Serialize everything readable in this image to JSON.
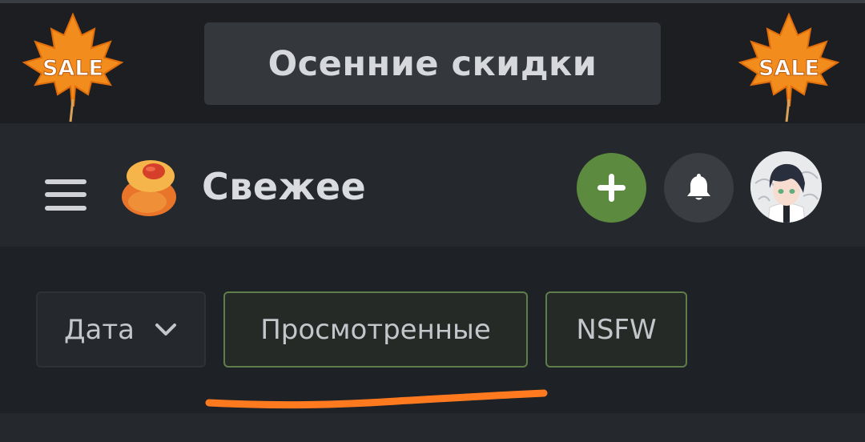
{
  "promo": {
    "button_label": "Осенние скидки",
    "badge_text": "SALE",
    "leaf_color": "#f28c1c"
  },
  "header": {
    "title": "Свежее",
    "add_icon": "plus-icon",
    "notification_icon": "bell-icon",
    "accent_green": "#5c8a3e"
  },
  "filters": {
    "date_label": "Дата",
    "date_icon": "chevron-down-icon",
    "viewed_label": "Просмотренные",
    "nsfw_label": "NSFW"
  },
  "annotation": {
    "underline_color": "#ff7a1f"
  }
}
